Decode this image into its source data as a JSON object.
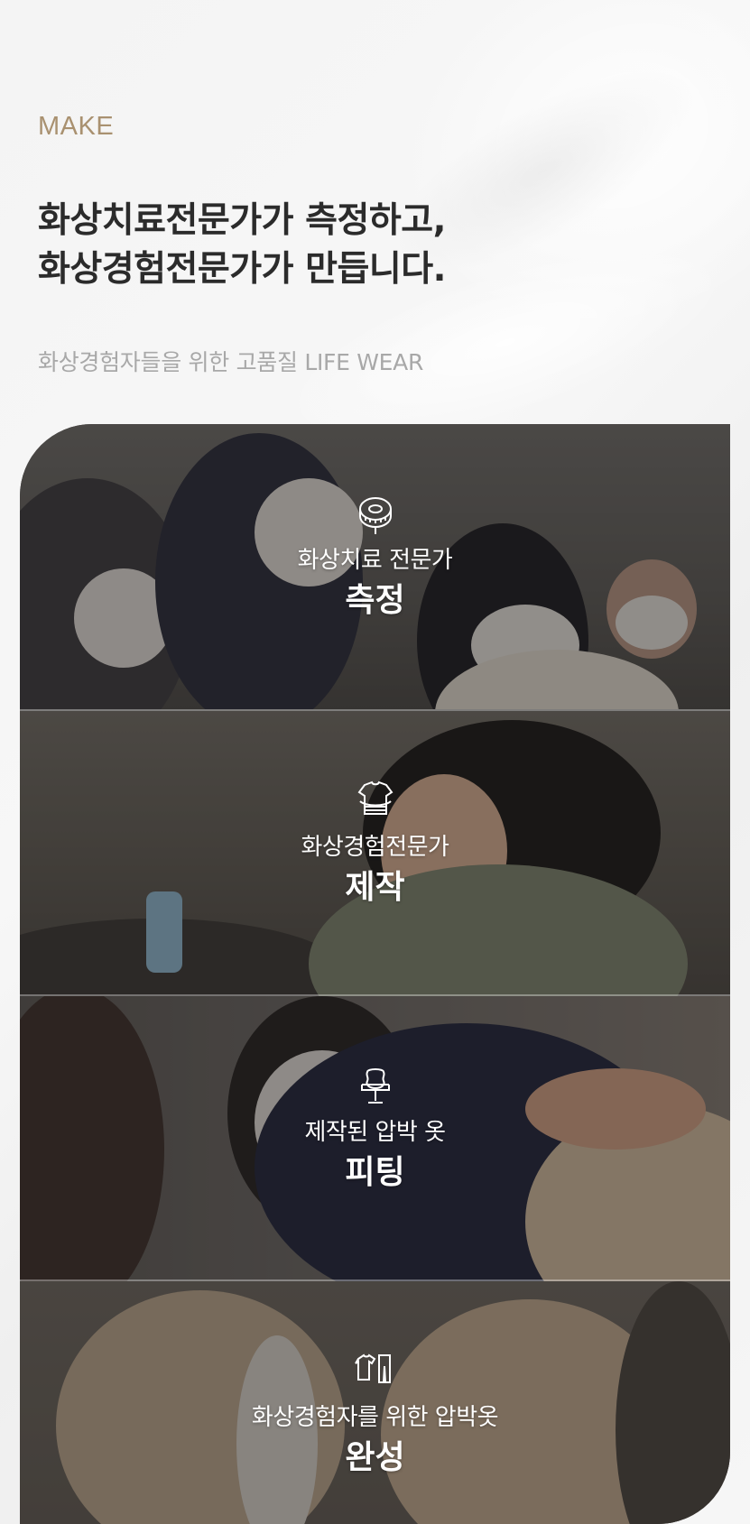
{
  "intro": {
    "eyebrow": "MAKE",
    "headline_line1": "화상치료전문가가 측정하고,",
    "headline_line2": "화상경험전문가가 만듭니다.",
    "subtitle": "화상경험자들을 위한 고품질 LIFE WEAR"
  },
  "steps": [
    {
      "icon": "measuring-tape-icon",
      "caption": "화상치료 전문가",
      "title": "측정"
    },
    {
      "icon": "garment-making-icon",
      "caption": "화상경험전문가",
      "title": "제작"
    },
    {
      "icon": "mannequin-fitting-icon",
      "caption": "제작된 압박 옷",
      "title": "피팅"
    },
    {
      "icon": "finished-clothes-icon",
      "caption": "화상경험자를 위한 압박옷",
      "title": "완성"
    }
  ],
  "colors": {
    "eyebrow": "#a99170",
    "headline": "#2b2b2b",
    "subtitle": "#a8a8a8",
    "overlay_text": "#ffffff"
  }
}
